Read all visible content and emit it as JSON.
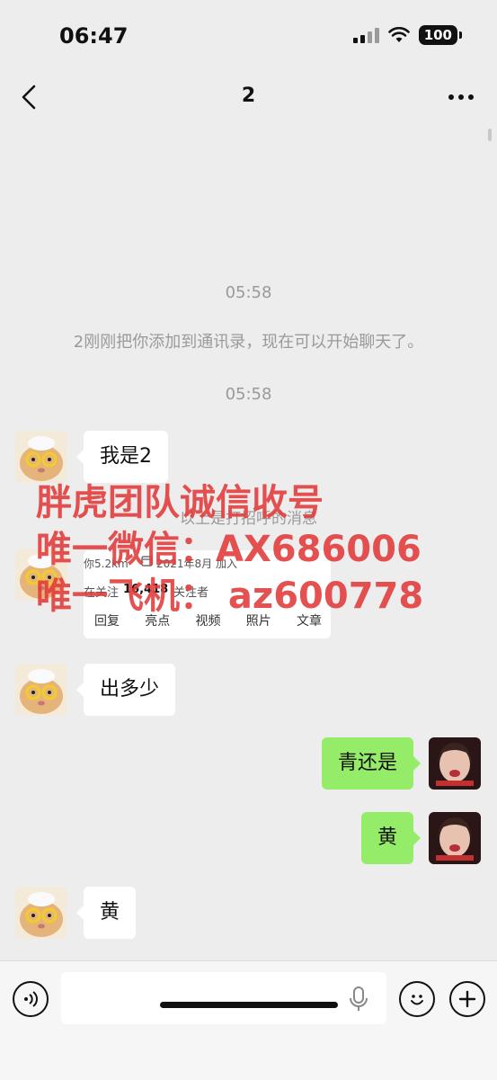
{
  "status_bar": {
    "time": "06:47",
    "battery": "100"
  },
  "nav": {
    "title": "2"
  },
  "messages": {
    "time1": "05:58",
    "system_note": "2刚刚把你添加到通讯录，现在可以开始聊天了。",
    "time2": "05:58",
    "m1": "我是2",
    "greeting_hint": "以上是打招呼的消息",
    "m3": "出多少",
    "m4": "青还是",
    "m5": "黄",
    "m6": "黄"
  },
  "profile_card": {
    "distance": "你5.2km",
    "joined": "2021年8月 加入",
    "following": "在关注",
    "followers_count": "16,418",
    "followers_label": "关注者",
    "tabs": [
      "回复",
      "亮点",
      "视频",
      "照片",
      "文章"
    ]
  },
  "watermark": {
    "line1": "胖虎团队诚信收号",
    "line2": "唯一微信：AX686006",
    "line3": "唯一飞机： az600778"
  },
  "colors": {
    "bubble_self": "#95ec69",
    "watermark": "#e23a3a",
    "background": "#ededed"
  }
}
